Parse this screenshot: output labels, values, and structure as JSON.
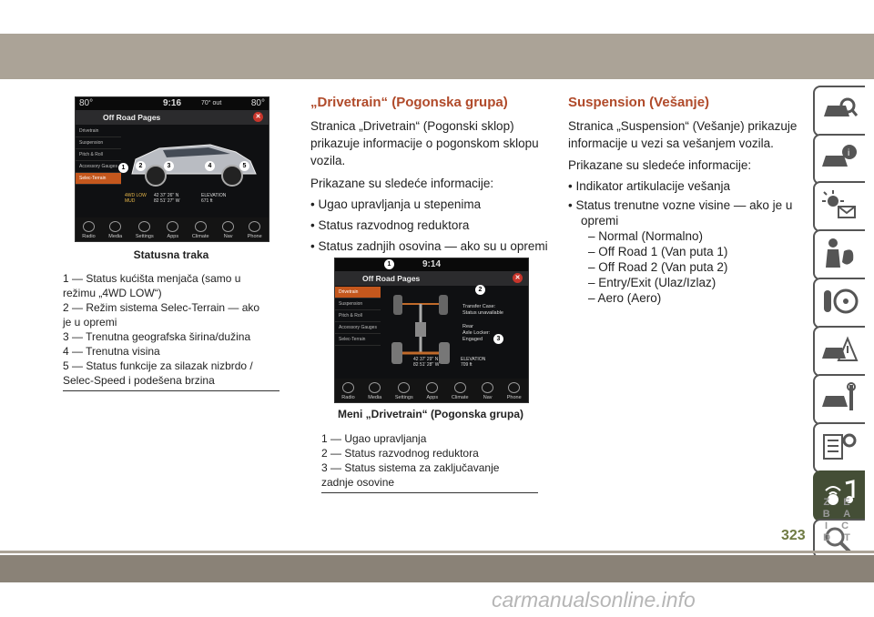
{
  "left": {
    "screen": {
      "status": {
        "temp_left": "80°",
        "time": "9:16",
        "outside": "70° out",
        "temp_right": "80°"
      },
      "title": "Off Road Pages",
      "side_items": [
        "Drivetrain",
        "Suspension",
        "Pitch & Roll",
        "Accessory Gauges",
        "Selec-Terrain"
      ],
      "readouts": [
        "4WD LOW",
        "MUD",
        "42 37' 26'' N",
        "82 51' 27'' W",
        "ELEVATION",
        "671 ft"
      ],
      "bottom": [
        "Radio",
        "Media",
        "Settings",
        "Apps",
        "Climate",
        "Nav",
        "Phone"
      ],
      "callouts": [
        "1",
        "2",
        "3",
        "4",
        "5"
      ]
    },
    "caption": "Statusna traka",
    "notes": [
      "1 — Status kućišta menjača (samo u",
      "režimu „4WD LOW“)",
      "2 — Režim sistema Selec-Terrain — ako",
      "je u opremi",
      "3 — Trenutna geografska širina/dužina",
      "4 — Trenutna visina",
      "5 — Status funkcije za silazak nizbrdo /",
      "Selec-Speed i podešena brzina"
    ]
  },
  "middle": {
    "heading": "„Drivetrain“ (Pogonska grupa)",
    "intro_lines": [
      "Stranica „Drivetrain“ (Pogonski sklop)",
      "prikazuje informacije o pogonskom sklopu",
      "vozila."
    ],
    "lead": "Prikazane su sledeće informacije:",
    "bullets": [
      "• Ugao upravljanja u stepenima",
      "• Status razvodnog reduktora",
      "• Status zadnjih osovina — ako su u opremi"
    ],
    "screen": {
      "time": "9:14",
      "title": "Off Road Pages",
      "side_items": [
        "Drivetrain",
        "Suspension",
        "Pitch & Roll",
        "Accessory Gauges",
        "Selec-Terrain"
      ],
      "info1": [
        "Transfer Case:",
        "Status unavailable"
      ],
      "info2": [
        "Rear",
        "Axle Locker:",
        "Engaged"
      ],
      "coords": [
        "42 37' 29'' N",
        "82 51' 28'' W",
        "ELEVATION",
        "709 ft"
      ],
      "bottom": [
        "Radio",
        "Media",
        "Settings",
        "Apps",
        "Climate",
        "Nav",
        "Phone"
      ],
      "callouts": [
        "1",
        "2",
        "3"
      ]
    },
    "caption": "Meni „Drivetrain“ (Pogonska grupa)",
    "notes": [
      "1 — Ugao upravljanja",
      "2 — Status razvodnog reduktora",
      "3 — Status sistema za zaključavanje",
      "zadnje osovine"
    ]
  },
  "right": {
    "heading": "Suspension (Vešanje)",
    "intro_lines": [
      "Stranica „Suspension“ (Vešanje) prikazuje",
      "informacije u vezi sa vešanjem vozila."
    ],
    "lead": "Prikazane su sledeće informacije:",
    "bullets": [
      "• Indikator artikulacije vešanja",
      "• Status trenutne vozne visine — ako je u",
      "opremi"
    ],
    "subitems": [
      "– Normal (Normalno)",
      "– Off Road 1 (Van puta 1)",
      "– Off Road 2 (Van puta 2)",
      "– Entry/Exit (Ulaz/Izlaz)",
      "– Aero (Aero)"
    ]
  },
  "tabs": [
    "car-search-icon",
    "car-info-icon",
    "warning-lights-icon",
    "seatbelt-airbag-icon",
    "steering-icon",
    "car-crash-icon",
    "car-service-icon",
    "specs-gear-icon",
    "multimedia-icon",
    "search-icon",
    "index-letters-icon"
  ],
  "index_letters": "Z E B A I C D T",
  "page_number": "323",
  "watermark": "carmanualsonline.info"
}
